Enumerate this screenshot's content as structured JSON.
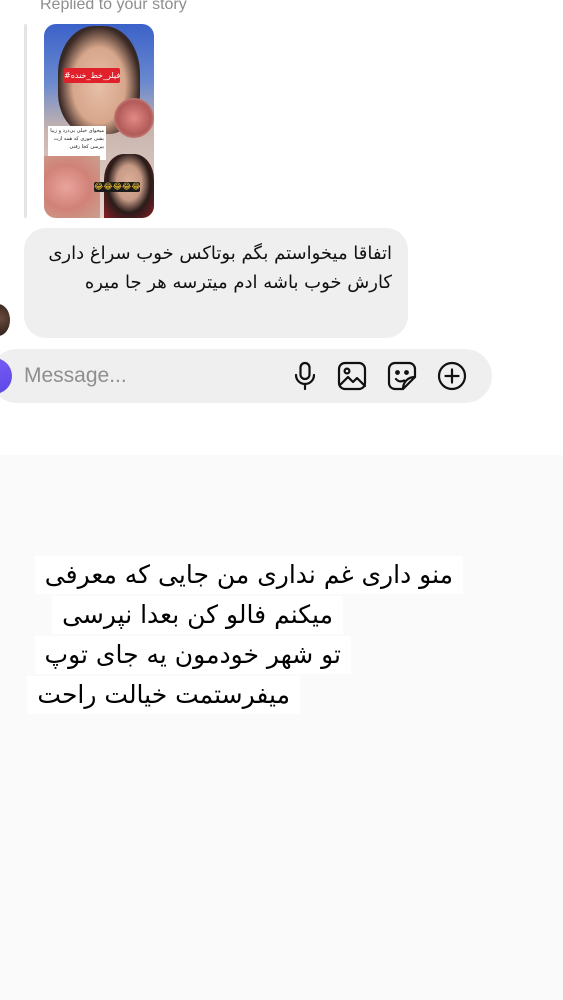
{
  "story_reply": {
    "label": "Replied to your story",
    "thumbnail": {
      "banner_text": "#فیلر_خط_خنده",
      "caption_text": "میخوای خیلی بی‌درد و زیبا بشی جوری که همه ازت بپرسن کجا رفتی",
      "emoji_strip": "😂😂😂😂😂"
    }
  },
  "message": {
    "text": "اتفاقا میخواستم بگم بوتاکس خوب سراغ داری  کارش خوب باشه ادم میترسه هر جا میره"
  },
  "composer": {
    "placeholder": "Message...",
    "icons": [
      "microphone-icon",
      "gallery-icon",
      "sticker-icon",
      "plus-circle-icon"
    ]
  },
  "caption_overlay": {
    "lines": [
      "منو داری غم نداری  من جایی که معرفی",
      "میکنم فالو کن بعدا نپرسی",
      "تو شهر خودمون یه جای توپ",
      "میفرستمت خیالت راحت"
    ]
  }
}
